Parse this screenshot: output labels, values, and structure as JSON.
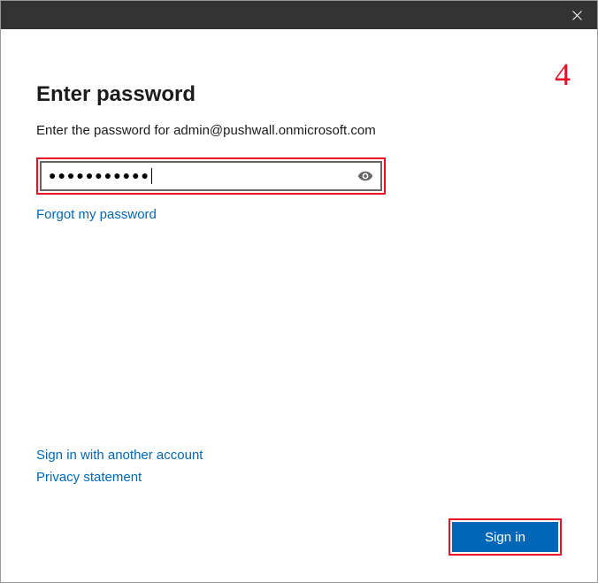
{
  "annotation": "4",
  "heading": "Enter password",
  "subtext": "Enter the password for admin@pushwall.onmicrosoft.com",
  "password_masked": "●●●●●●●●●●●",
  "forgot_link": "Forgot my password",
  "another_account_link": "Sign in with another account",
  "privacy_link": "Privacy statement",
  "signin_label": "Sign in"
}
